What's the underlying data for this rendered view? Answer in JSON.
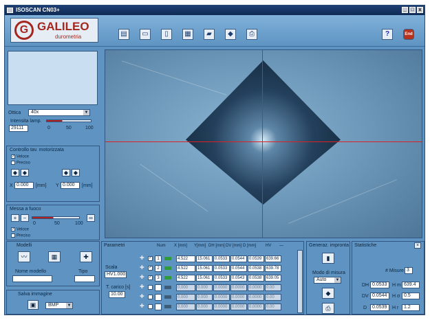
{
  "window": {
    "title": "ISOSCAN CN03+",
    "controls": [
      "_",
      "□",
      "x"
    ]
  },
  "logo": {
    "name": "GALILEO",
    "sub": "durometria",
    "mark": "G"
  },
  "toolbar": {
    "tools": [
      {
        "name": "report-icon",
        "glyph": "▤"
      },
      {
        "name": "layout-icon",
        "glyph": "▭"
      },
      {
        "name": "document-icon",
        "glyph": "▯"
      },
      {
        "name": "grid-icon",
        "glyph": "▦"
      },
      {
        "name": "folder-icon",
        "glyph": "▰"
      },
      {
        "name": "indenter-icon",
        "glyph": "◆"
      },
      {
        "name": "printer-icon",
        "glyph": "⎙"
      }
    ],
    "help": "?",
    "end": "End"
  },
  "objective": {
    "label": "Ottica",
    "value": "40x"
  },
  "lamp": {
    "label": "Intensita lamp.",
    "value_field": "29111",
    "ticks": [
      "0",
      "50",
      "100"
    ],
    "level": 0.35
  },
  "motor_panel": {
    "title": "Controllo tav. motorizzata",
    "opt1": "Veloce",
    "opt2": "Preciso",
    "x_label": "X",
    "x_value": "0.000",
    "x_unit": "[mm]",
    "y_label": "Y",
    "y_value": "0.000",
    "y_unit": "[mm]"
  },
  "focus_panel": {
    "title": "Messa a fuoco",
    "ticks": [
      "0",
      "50",
      "100"
    ],
    "opt1": "Veloce",
    "opt2": "Preciso",
    "level": 0.45
  },
  "models": {
    "title": "Modelli",
    "name_label": "Nome modello",
    "type_label": "Tipo"
  },
  "save_image": {
    "title": "Salva immagine",
    "format": "BMP"
  },
  "params": {
    "title": "Parametri",
    "scale_label": "Scala",
    "scale_value": "HV1.000",
    "load_time_label": "T. carico [s]",
    "load_time_value": "10.00"
  },
  "table": {
    "headers": [
      "Num",
      "X [mm]",
      "Y[mm]",
      "DH [mm]",
      "DV [mm]",
      "D [mm]",
      "HV",
      "—"
    ],
    "rows": [
      {
        "num": "1",
        "x": "4.522",
        "y": "15.061",
        "dh": "0.0533",
        "dv": "0.0544",
        "d": "0.0539",
        "hv": "639.66",
        "active": true
      },
      {
        "num": "2",
        "x": "4.522",
        "y": "15.061",
        "dh": "0.0533",
        "dv": "0.0544",
        "d": "0.0538",
        "hv": "639.78",
        "active": true
      },
      {
        "num": "3",
        "x": "4.522",
        "y": "15.061",
        "dh": "0.0533",
        "dv": "0.0543",
        "d": "0.0538",
        "hv": "639.05",
        "active": true
      },
      {
        "num": "",
        "x": "0.000",
        "y": "0.000",
        "dh": "0.0000",
        "dv": "0.0000",
        "d": "0.0000",
        "hv": "0.00",
        "active": false
      },
      {
        "num": "",
        "x": "0.000",
        "y": "0.000",
        "dh": "0.0000",
        "dv": "0.0000",
        "d": "0.0000",
        "hv": "0.00",
        "active": false
      },
      {
        "num": "",
        "x": "0.000",
        "y": "0.000",
        "dh": "0.0000",
        "dv": "0.0000",
        "d": "0.0000",
        "hv": "0.00",
        "active": false
      }
    ]
  },
  "impronta": {
    "title": "Generaz. impronta",
    "mode_label": "Modo di misura",
    "mode_value": "Auto"
  },
  "stats": {
    "title": "Statistiche",
    "count_label": "# Misure",
    "count_value": "3",
    "dh_label": "DH",
    "dh_value": "0.0533",
    "dv_label": "DV",
    "dv_value": "0.0544",
    "d_label": "D",
    "d_value": "0.0539",
    "hm_label": "H m",
    "hm_value": "639.4",
    "hsigma_label": "H σ",
    "hsigma_value": "0.5",
    "hr_label": "H r",
    "hr_value": "1.2"
  },
  "colors": {
    "window_bg": "#5f94c2",
    "accent_red": "#a5261f",
    "title_bar": "#0f2a55"
  }
}
